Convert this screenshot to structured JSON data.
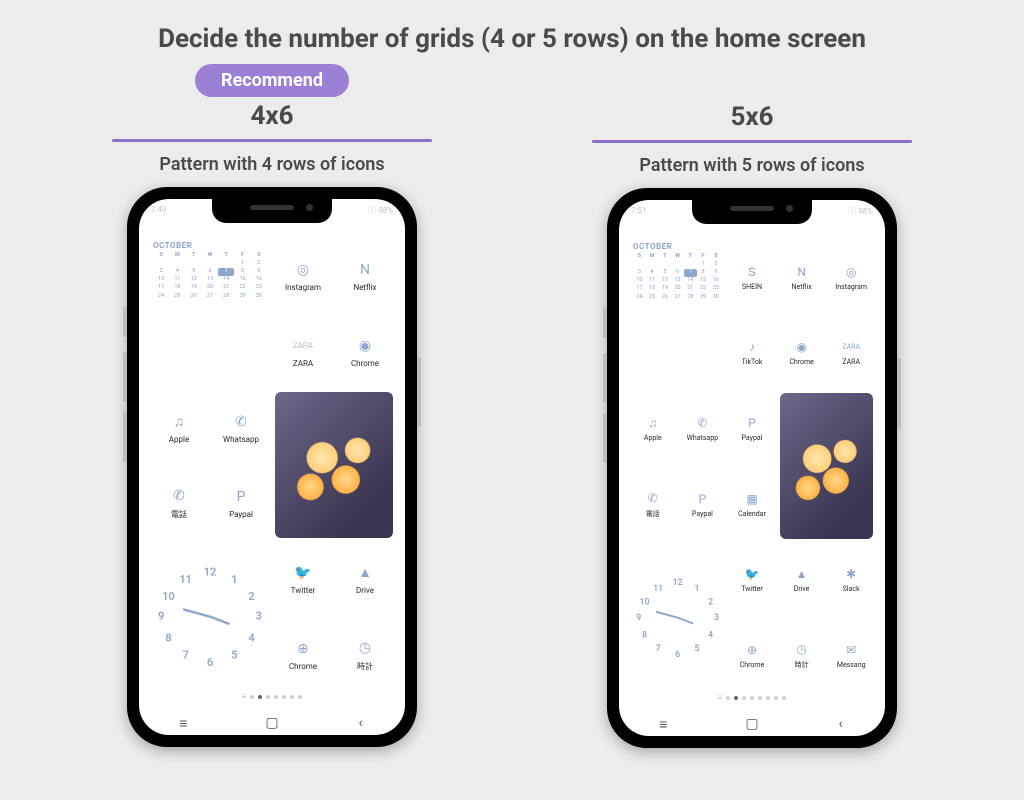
{
  "page": {
    "title": "Decide the number of grids (4 or 5 rows) on the home screen",
    "recommend_badge": "Recommend"
  },
  "colors": {
    "accent": "#9b7fd4",
    "underline": "#8b72c7",
    "icon": "#8ea6cc"
  },
  "left": {
    "grid_label": "4x6",
    "caption": "Pattern with 4 rows of icons",
    "status": {
      "time": "7:49",
      "signal": "♁",
      "battery": "ⓘ 98%"
    },
    "calendar": {
      "month": "OCTOBER",
      "days": [
        "S",
        "M",
        "T",
        "W",
        "T",
        "F",
        "S"
      ],
      "today": 7
    },
    "apps": {
      "r1": [
        {
          "icon": "instagram",
          "label": "Instagram"
        },
        {
          "icon": "n",
          "label": "Netflix"
        }
      ],
      "r2": [
        {
          "icon": "zara",
          "label": "ZARA"
        },
        {
          "icon": "chrome",
          "label": "Chrome"
        }
      ],
      "r3": [
        {
          "icon": "music",
          "label": "Apple"
        },
        {
          "icon": "whatsapp",
          "label": "Whatsapp"
        }
      ],
      "r4": [
        {
          "icon": "phone",
          "label": "電話"
        },
        {
          "icon": "paypal",
          "label": "Paypal"
        }
      ],
      "r5": [
        {
          "icon": "twitter",
          "label": "Twitter"
        },
        {
          "icon": "drive",
          "label": "Drive"
        }
      ],
      "r6": [
        {
          "icon": "compass",
          "label": "Chrome"
        },
        {
          "icon": "clock",
          "label": "時計"
        }
      ]
    }
  },
  "right": {
    "grid_label": "5x6",
    "caption": "Pattern with 5 rows of icons",
    "status": {
      "time": "7:51",
      "signal": "♁",
      "battery": "ⓘ 98%"
    },
    "calendar": {
      "month": "OCTOBER",
      "days": [
        "S",
        "M",
        "T",
        "W",
        "T",
        "F",
        "S"
      ],
      "today": 7
    },
    "apps": {
      "r1": [
        {
          "icon": "s",
          "label": "SHEIN"
        },
        {
          "icon": "n",
          "label": "Netflix"
        },
        {
          "icon": "instagram",
          "label": "Instagram"
        }
      ],
      "r2": [
        {
          "icon": "tiktok",
          "label": "TikTok"
        },
        {
          "icon": "chrome",
          "label": "Chrome"
        },
        {
          "icon": "zara",
          "label": "ZARA"
        }
      ],
      "r3": [
        {
          "icon": "music",
          "label": "Apple"
        },
        {
          "icon": "whatsapp",
          "label": "Whatsapp"
        },
        {
          "icon": "paypal",
          "label": "Paypal"
        }
      ],
      "r4": [
        {
          "icon": "phone",
          "label": "電話"
        },
        {
          "icon": "paypal",
          "label": "Paypal"
        },
        {
          "icon": "calendar",
          "label": "Calendar"
        }
      ],
      "r5": [
        {
          "icon": "twitter",
          "label": "Twitter"
        },
        {
          "icon": "drive",
          "label": "Drive"
        },
        {
          "icon": "slack",
          "label": "Slack"
        }
      ],
      "r6": [
        {
          "icon": "compass",
          "label": "Chrome"
        },
        {
          "icon": "clock",
          "label": "時計"
        },
        {
          "icon": "messenger",
          "label": "Messang"
        }
      ]
    }
  }
}
